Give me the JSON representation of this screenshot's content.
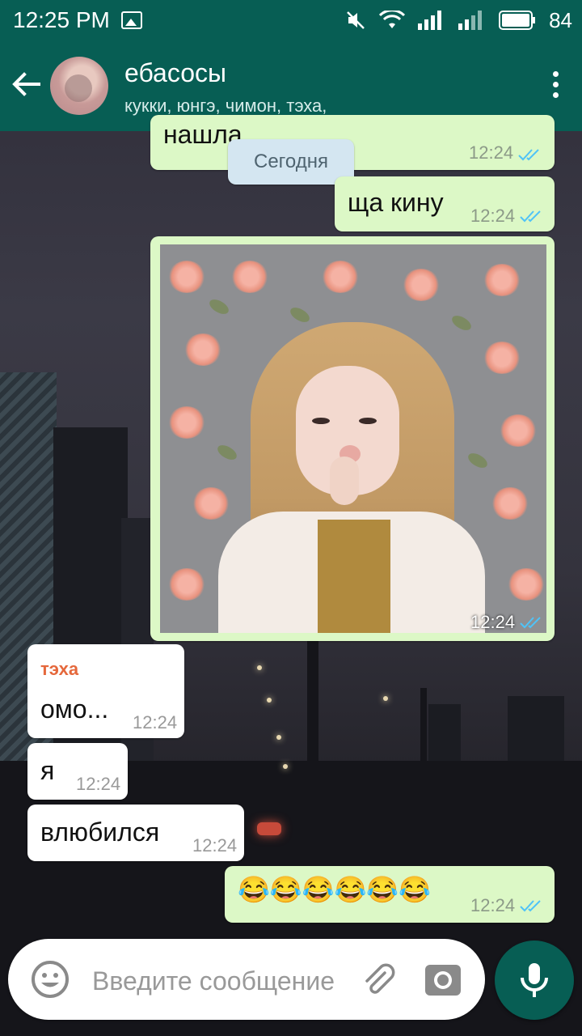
{
  "status_bar": {
    "time": "12:25 PM",
    "battery": "84"
  },
  "header": {
    "title": "ебасосы",
    "participants": "кукки, юнгэ, чимон, тэха,"
  },
  "date_chip": "Сегодня",
  "messages": [
    {
      "direction": "out",
      "text": "нашла",
      "time": "12:24",
      "status": "read"
    },
    {
      "direction": "out",
      "text": "ща кину",
      "time": "12:24",
      "status": "read"
    },
    {
      "direction": "out",
      "type": "photo",
      "time": "12:24",
      "status": "read"
    },
    {
      "direction": "in",
      "sender": "тэха",
      "text": "омо...",
      "time": "12:24"
    },
    {
      "direction": "in",
      "text": "я",
      "time": "12:24"
    },
    {
      "direction": "in",
      "text": "влюбился",
      "time": "12:24"
    },
    {
      "direction": "out",
      "text": "😂😂😂😂😂😂",
      "time": "12:24",
      "status": "read"
    }
  ],
  "composer": {
    "placeholder": "Введите сообщение"
  },
  "colors": {
    "brand": "#075e54",
    "outgoing_bubble": "#dcf8c6",
    "incoming_bubble": "#ffffff",
    "read_ticks": "#4fc3f7",
    "sender_name": "#e5683c"
  },
  "icons": {
    "back": "arrow-left-icon",
    "menu": "more-vertical-icon",
    "emoji": "smiley-icon",
    "attach": "paperclip-icon",
    "camera": "camera-icon",
    "mic": "microphone-icon"
  }
}
